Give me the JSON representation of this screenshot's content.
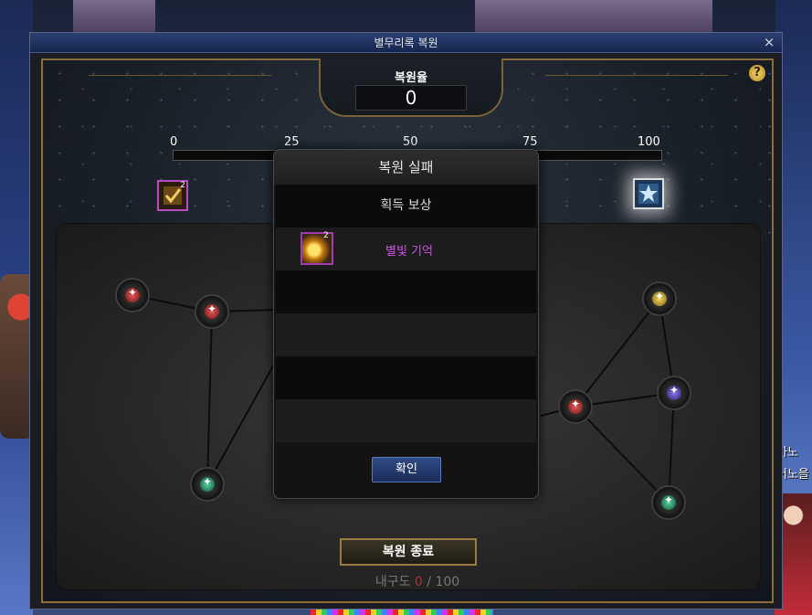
{
  "window": {
    "title": "별무리록 복원",
    "close_glyph": "×",
    "help_glyph": "?"
  },
  "restore_rate": {
    "label": "복원율",
    "value": "0",
    "progress": 0
  },
  "scale": {
    "ticks": [
      "0",
      "25",
      "50",
      "75",
      "100"
    ]
  },
  "milestone_rewards": [
    {
      "icon": "checkmark-scroll-icon",
      "count": "2"
    },
    {
      "icon": "star-crystal-icon",
      "count": ""
    }
  ],
  "board": {
    "end_button_label": "복원 종료",
    "durability_label": "내구도",
    "durability_current": "0",
    "durability_max": "/ 100",
    "nodes": [
      {
        "color": "red"
      },
      {
        "color": "red"
      },
      {
        "color": "green"
      },
      {
        "color": "gold"
      },
      {
        "color": "purple"
      },
      {
        "color": "red"
      },
      {
        "color": "green"
      }
    ]
  },
  "dialog": {
    "title": "복원 실패",
    "reward_header": "획득 보상",
    "items": [
      {
        "name": "별빛 기억",
        "count": "2",
        "icon": "starlight-memory-icon"
      }
    ],
    "confirm_label": "확인"
  },
  "side_chat": {
    "line1": "마노",
    "line2": "어노을"
  },
  "colors": {
    "frame_gold": "#8a6e3c",
    "titlebar_blue": "#1f3366",
    "item_name_purple": "#d84cf0",
    "progress_fill": "#d8b247"
  }
}
